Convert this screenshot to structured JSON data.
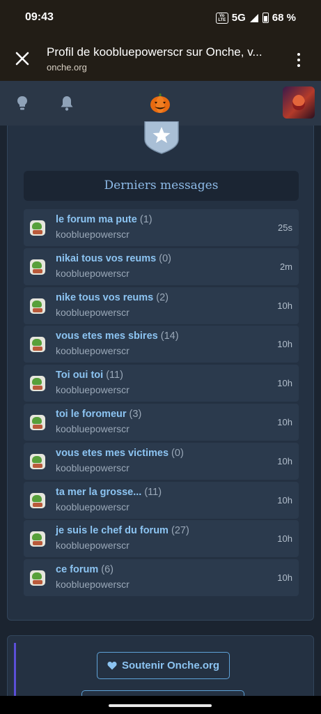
{
  "status_bar": {
    "time": "09:43",
    "volte": "Vo LTE",
    "network": "5G",
    "battery": "68 %"
  },
  "browser": {
    "title": "Profil de koobluepowerscr sur Onche, v...",
    "url": "onche.org",
    "close_icon": "close-icon",
    "menu_icon": "more-vert-icon"
  },
  "header": {
    "icons": [
      "lightbulb-icon",
      "bell-icon",
      "pumpkin-logo",
      "avatar"
    ]
  },
  "recent": {
    "heading": "Derniers messages",
    "messages": [
      {
        "title": "le forum ma pute",
        "count": "(1)",
        "author": "koobluepowerscr",
        "time": "25s"
      },
      {
        "title": "nikai tous vos reums",
        "count": "(0)",
        "author": "koobluepowerscr",
        "time": "2m"
      },
      {
        "title": "nike tous vos reums",
        "count": "(2)",
        "author": "koobluepowerscr",
        "time": "10h"
      },
      {
        "title": "vous etes mes sbires",
        "count": "(14)",
        "author": "koobluepowerscr",
        "time": "10h"
      },
      {
        "title": "Toi oui toi",
        "count": "(11)",
        "author": "koobluepowerscr",
        "time": "10h"
      },
      {
        "title": "toi le foromeur",
        "count": "(3)",
        "author": "koobluepowerscr",
        "time": "10h"
      },
      {
        "title": "vous etes mes victimes",
        "count": "(0)",
        "author": "koobluepowerscr",
        "time": "10h"
      },
      {
        "title": "ta mer la grosse...",
        "count": "(11)",
        "author": "koobluepowerscr",
        "time": "10h"
      },
      {
        "title": "je suis le chef du forum",
        "count": "(27)",
        "author": "koobluepowerscr",
        "time": "10h"
      },
      {
        "title": "ce forum",
        "count": "(6)",
        "author": "koobluepowerscr",
        "time": "10h"
      }
    ]
  },
  "footer": {
    "support_label": "Soutenir Onche.org"
  },
  "colors": {
    "accent": "#8cc4f2",
    "background": "#1b2430",
    "card": "#243142"
  }
}
